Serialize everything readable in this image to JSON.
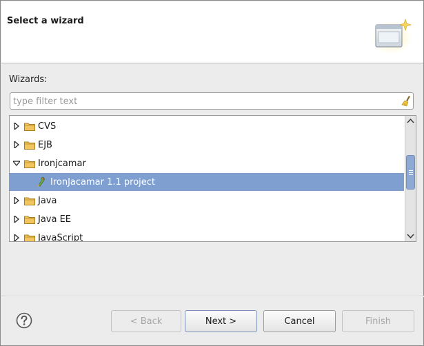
{
  "dialog": {
    "title": "Select a wizard",
    "banner_icon": "wizard-banner-icon"
  },
  "filter": {
    "label": "Wizards:",
    "value": "",
    "placeholder": "type filter text",
    "clear_icon": "broom-clear-icon"
  },
  "tree": {
    "items": [
      {
        "label": "CVS",
        "expanded": false,
        "icon": "folder-icon"
      },
      {
        "label": "EJB",
        "expanded": false,
        "icon": "folder-icon"
      },
      {
        "label": "Ironjcamar",
        "expanded": true,
        "icon": "folder-icon"
      },
      {
        "label": "IronJacamar 1.1 project",
        "selected": true,
        "icon": "ironjacamar-project-icon"
      },
      {
        "label": "Java",
        "expanded": false,
        "icon": "folder-icon"
      },
      {
        "label": "Java EE",
        "expanded": false,
        "icon": "folder-icon"
      },
      {
        "label": "JavaScript",
        "expanded": false,
        "icon": "folder-icon"
      }
    ]
  },
  "buttons": {
    "back": "< Back",
    "next": "Next >",
    "cancel": "Cancel",
    "finish": "Finish"
  },
  "colors": {
    "selection": "#7e9fd0",
    "folder": "#e8b64a"
  }
}
